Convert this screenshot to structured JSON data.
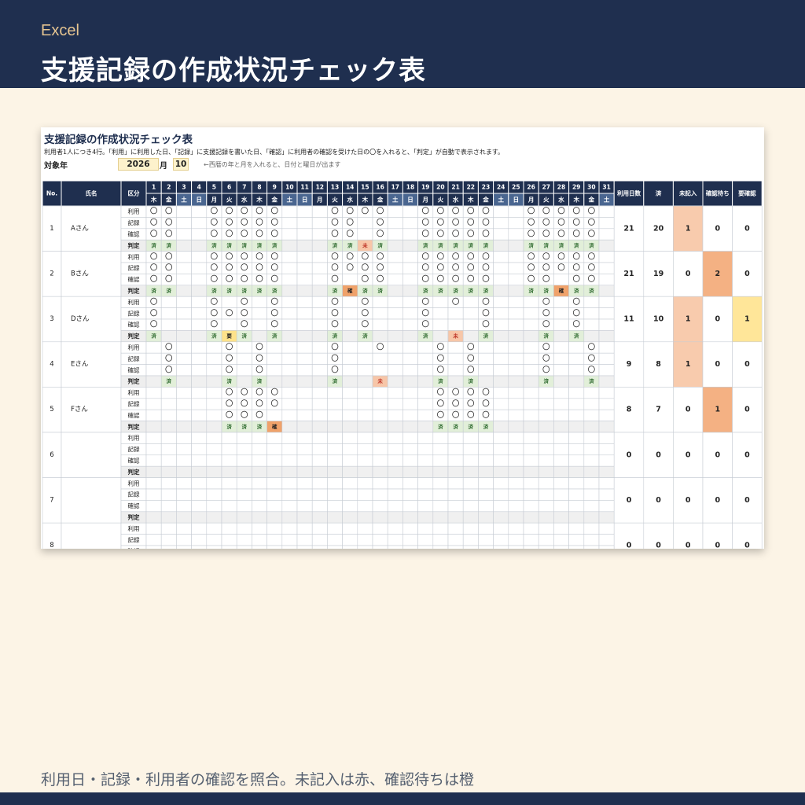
{
  "header": {
    "app": "Excel",
    "title": "支援記録の作成状況チェック表"
  },
  "sheet": {
    "title": "支援記録の作成状況チェック表",
    "description": "利用者1人につき4行。「利用」に利用した日、「記録」に支援記録を書いた日、「確認」に利用者の確認を受けた日の〇を入れると、「判定」が自動で表示されます。",
    "year_label": "対象年",
    "year": "2026",
    "month_label": "月",
    "month": "10",
    "hint": "←西暦の年と月を入れると、日付と曜日が出ます"
  },
  "table": {
    "headers": {
      "no": "No.",
      "name": "氏名",
      "kind": "区分",
      "days_used": "利用日数",
      "done": "済",
      "missing": "未記入",
      "pending": "確認待ち",
      "needs_check": "要確認"
    },
    "weekdays": [
      "木",
      "金",
      "土",
      "日",
      "月",
      "火",
      "水",
      "木",
      "金",
      "土",
      "日",
      "月",
      "火",
      "水",
      "木",
      "金",
      "土",
      "日",
      "月",
      "火",
      "水",
      "木",
      "金",
      "土",
      "日",
      "月",
      "火",
      "水",
      "木",
      "金",
      "土"
    ],
    "row_kinds": [
      "利用",
      "記録",
      "確認",
      "判定"
    ],
    "mark": "〇",
    "status_labels": {
      "ok": "済",
      "missing": "未",
      "pending": "確",
      "needs_check": "要"
    },
    "status_colors": {
      "ok": "#e2efd9",
      "missing": "#f7c6a8",
      "pending": "#f0a26a",
      "needs_check": "#fde28a"
    },
    "summary_colors": {
      "missing": "#f8cbad",
      "pending": "#f4b183",
      "needs_check": "#ffe699"
    },
    "users": [
      {
        "no": "1",
        "name": "Aさん",
        "use": [
          1,
          2,
          5,
          6,
          7,
          8,
          9,
          13,
          14,
          15,
          16,
          19,
          20,
          21,
          22,
          23,
          26,
          27,
          28,
          29,
          30
        ],
        "record": [
          1,
          2,
          5,
          6,
          7,
          8,
          9,
          13,
          14,
          16,
          19,
          20,
          21,
          22,
          23,
          26,
          27,
          28,
          29,
          30
        ],
        "confirm": [
          1,
          2,
          5,
          6,
          7,
          8,
          9,
          13,
          14,
          16,
          19,
          20,
          21,
          22,
          23,
          26,
          27,
          28,
          29,
          30
        ],
        "judge": {
          "ok": [
            1,
            2,
            5,
            6,
            7,
            8,
            9,
            13,
            14,
            16,
            19,
            20,
            21,
            22,
            23,
            26,
            27,
            28,
            29,
            30
          ],
          "missing": [
            15
          ],
          "pending": [],
          "needs_check": []
        },
        "days": "21",
        "done": "20",
        "missing": "1",
        "pending": "0",
        "needs_check": "0"
      },
      {
        "no": "2",
        "name": "Bさん",
        "use": [
          1,
          2,
          5,
          6,
          7,
          8,
          9,
          13,
          14,
          15,
          16,
          19,
          20,
          21,
          22,
          23,
          26,
          27,
          28,
          29,
          30
        ],
        "record": [
          1,
          2,
          5,
          6,
          7,
          8,
          9,
          13,
          14,
          15,
          16,
          19,
          20,
          21,
          22,
          23,
          26,
          27,
          28,
          29,
          30
        ],
        "confirm": [
          1,
          2,
          5,
          6,
          7,
          8,
          9,
          13,
          15,
          16,
          19,
          20,
          21,
          22,
          23,
          26,
          27,
          29,
          30
        ],
        "judge": {
          "ok": [
            1,
            2,
            5,
            6,
            7,
            8,
            9,
            13,
            15,
            16,
            19,
            20,
            21,
            22,
            23,
            26,
            27,
            29,
            30
          ],
          "missing": [],
          "pending": [
            14,
            28
          ],
          "needs_check": []
        },
        "days": "21",
        "done": "19",
        "missing": "0",
        "pending": "2",
        "needs_check": "0"
      },
      {
        "no": "3",
        "name": "Dさん",
        "use": [
          1,
          5,
          7,
          9,
          13,
          15,
          19,
          21,
          23,
          27,
          29
        ],
        "record": [
          1,
          5,
          6,
          7,
          9,
          13,
          15,
          19,
          23,
          27,
          29
        ],
        "confirm": [
          1,
          5,
          7,
          9,
          13,
          15,
          19,
          23,
          27,
          29
        ],
        "judge": {
          "ok": [
            1,
            5,
            7,
            9,
            13,
            15,
            19,
            23,
            27,
            29
          ],
          "missing": [
            21
          ],
          "pending": [],
          "needs_check": [
            6
          ]
        },
        "days": "11",
        "done": "10",
        "missing": "1",
        "pending": "0",
        "needs_check": "1"
      },
      {
        "no": "4",
        "name": "Eさん",
        "use": [
          2,
          6,
          8,
          13,
          16,
          20,
          22,
          27,
          30
        ],
        "record": [
          2,
          6,
          8,
          13,
          20,
          22,
          27,
          30
        ],
        "confirm": [
          2,
          6,
          8,
          13,
          20,
          22,
          27,
          30
        ],
        "judge": {
          "ok": [
            2,
            6,
            8,
            13,
            20,
            22,
            27,
            30
          ],
          "missing": [
            16
          ],
          "pending": [],
          "needs_check": []
        },
        "days": "9",
        "done": "8",
        "missing": "1",
        "pending": "0",
        "needs_check": "0"
      },
      {
        "no": "5",
        "name": "Fさん",
        "use": [
          6,
          7,
          8,
          9,
          20,
          21,
          22,
          23
        ],
        "record": [
          6,
          7,
          8,
          9,
          20,
          21,
          22,
          23
        ],
        "confirm": [
          6,
          7,
          8,
          20,
          21,
          22,
          23
        ],
        "judge": {
          "ok": [
            6,
            7,
            8,
            20,
            21,
            22,
            23
          ],
          "missing": [],
          "pending": [
            9
          ],
          "needs_check": []
        },
        "days": "8",
        "done": "7",
        "missing": "0",
        "pending": "1",
        "needs_check": "0"
      },
      {
        "no": "6",
        "name": "",
        "use": [],
        "record": [],
        "confirm": [],
        "judge": {
          "ok": [],
          "missing": [],
          "pending": [],
          "needs_check": []
        },
        "days": "0",
        "done": "0",
        "missing": "0",
        "pending": "0",
        "needs_check": "0"
      },
      {
        "no": "7",
        "name": "",
        "use": [],
        "record": [],
        "confirm": [],
        "judge": {
          "ok": [],
          "missing": [],
          "pending": [],
          "needs_check": []
        },
        "days": "0",
        "done": "0",
        "missing": "0",
        "pending": "0",
        "needs_check": "0"
      },
      {
        "no": "8",
        "name": "",
        "use": [],
        "record": [],
        "confirm": [],
        "judge": {
          "ok": [],
          "missing": [],
          "pending": [],
          "needs_check": []
        },
        "days": "0",
        "done": "0",
        "missing": "0",
        "pending": "0",
        "needs_check": "0"
      }
    ]
  },
  "footer": {
    "caption": "利用日・記録・利用者の確認を照合。未記入は赤、確認待ちは橙"
  },
  "colors": {
    "banner": "#1f2f4f",
    "accent": "#e6c591",
    "header_fill": "#1f2f4f",
    "weekend_fill": "#4a6690",
    "background": "#fcf4e6"
  }
}
